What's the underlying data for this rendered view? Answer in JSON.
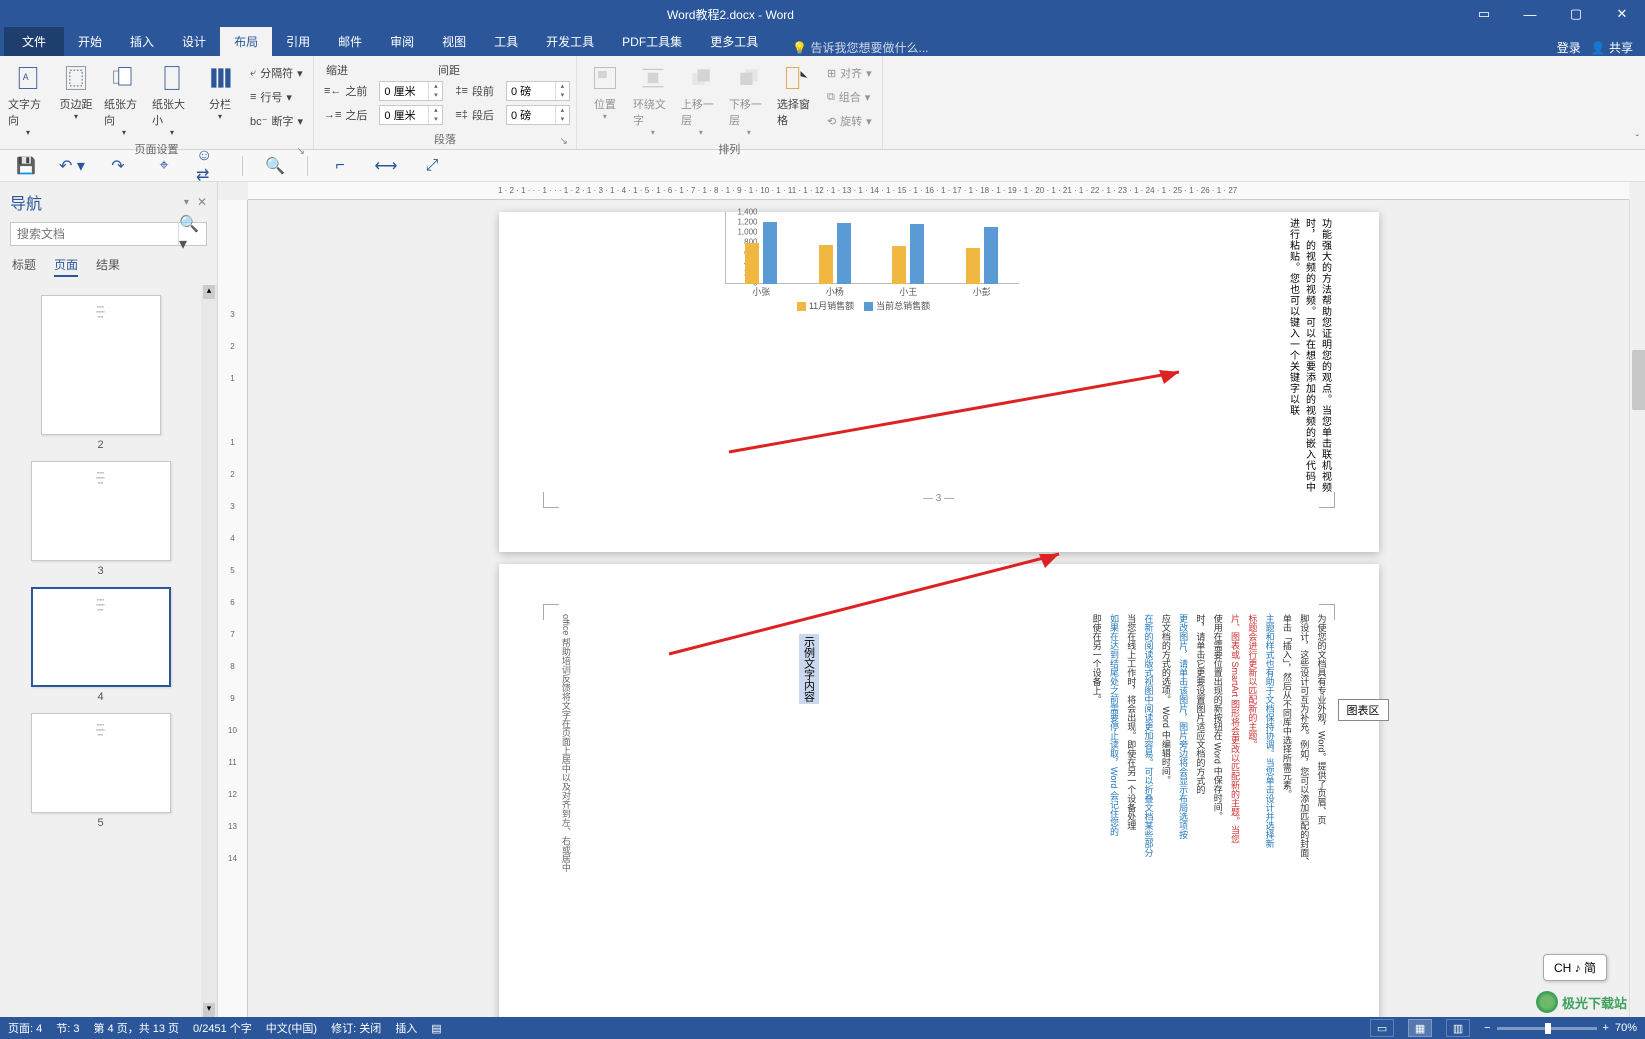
{
  "titlebar": {
    "title": "Word教程2.docx - Word",
    "btn_opts": "⋯",
    "min": "—",
    "max": "▢",
    "close": "✕",
    "ribbon_display": "▭"
  },
  "tabs": {
    "file": "文件",
    "items": [
      "开始",
      "插入",
      "设计",
      "布局",
      "引用",
      "邮件",
      "审阅",
      "视图",
      "工具",
      "开发工具",
      "PDF工具集",
      "更多工具"
    ],
    "active": "布局",
    "tell_me": "告诉我您想要做什么...",
    "login": "登录",
    "share": "共享"
  },
  "ribbon": {
    "page_setup": {
      "label": "页面设置",
      "text_dir": "文字方向",
      "margins": "页边距",
      "orientation": "纸张方向",
      "size": "纸张大小",
      "columns": "分栏",
      "breaks": "分隔符",
      "line_no": "行号",
      "hyphen": "断字"
    },
    "paragraph": {
      "label": "段落",
      "indent_label": "缩进",
      "before_label": "之前",
      "after_label": "之后",
      "left_val": "0 厘米",
      "right_val": "0 厘米",
      "spacing_label": "间距",
      "sp_before_label": "段前",
      "sp_after_label": "段后",
      "sp_before_val": "0 磅",
      "sp_after_val": "0 磅"
    },
    "arrange": {
      "label": "排列",
      "position": "位置",
      "wrap": "环绕文字",
      "forward": "上移一层",
      "backward": "下移一层",
      "selection": "选择窗格",
      "align": "对齐",
      "group": "组合",
      "rotate": "旋转"
    }
  },
  "qat": {
    "items": [
      "save",
      "undo",
      "redo",
      "touch",
      "coauth",
      "find",
      "tab-stops",
      "ruler",
      "outline"
    ]
  },
  "nav": {
    "title": "导航",
    "search_ph": "搜索文档",
    "subtabs": [
      "标题",
      "页面",
      "结果"
    ],
    "active": "页面",
    "thumbs": [
      {
        "n": "2",
        "landscape": false
      },
      {
        "n": "3",
        "landscape": true
      },
      {
        "n": "4",
        "landscape": true,
        "selected": true
      },
      {
        "n": "5",
        "landscape": true
      }
    ]
  },
  "chart_data": {
    "type": "bar",
    "categories": [
      "小张",
      "小杨",
      "小王",
      "小彭"
    ],
    "series": [
      {
        "name": "11月销售额",
        "values": [
          800,
          760,
          740,
          700
        ],
        "color": "#f0b840"
      },
      {
        "name": "当前总销售额",
        "values": [
          1200,
          1180,
          1160,
          1100
        ],
        "color": "#5b9bd5"
      }
    ],
    "ylim": [
      0,
      1400
    ],
    "yticks": [
      0,
      200,
      400,
      600,
      800,
      1000,
      1200,
      1400
    ],
    "title": "",
    "xlabel": "",
    "ylabel": ""
  },
  "doc": {
    "page3_vert": "功能强大的方法帮助您证明您的观点。当您单击联机视频时，的视频的视频。可以在想要添加的视频的嵌入代码中进行粘贴。您也可以键入一个关键字以联",
    "page3_num": "— 3 —",
    "page4_cols": [
      "为使您的文档具有专业外观，Word。提供了页眉、页",
      "脚设计，这些设计可互为补充。例如，您可以添加匹配的封面、",
      "单击「插入」，然后从不同库中选择所需元素。",
      "主题和样式也有助于文档保持协调。当您单击设计并选择新",
      "标题会进行更新以匹配新的主题。",
      "片、图表或 SmartArt 图形将会更改以匹配新的主题。当您",
      "使用在需要位置出现的新按钮在 Word 中保存时间。",
      "时，请单击它更要设置图片适应文档的方式的",
      "更改图片，请单击该图片，图片旁边将会显示布局选项按",
      "应文档的方式的选项。  Word 中编辑时间。",
      "在新的阅读版式视图中阅读更加容易。可以折叠文档某些部分",
      "当您在线上工作时，将会出现。即使在另一个设备处理",
      "如果在达到结尾处之前需要停止读取，Word 会记住您的",
      "即使在另一个设备上。"
    ],
    "page4_left": "office 帮助培训反馈将文字在页面上居中以及对齐到左、右或居中",
    "page4_sel": "示例文字内容"
  },
  "tooltip": "图表区",
  "hruler": "1 · 2 · 1 · · · 1 · · · 1 · 2 · 1 · 3 · 1 · 4 · 1 · 5 · 1 · 6 · 1 · 7 · 1 · 8 · 1 · 9 · 1 · 10 · 1 · 11 · 1 · 12 · 1 · 13 · 1 · 14 · 1 · 15 · 1 · 16 · 1 · 17 · 1 · 18 · 1 · 19 · 1 · 20 · 1 · 21 · 1 · 22 · 1 · 23 · 1 · 24 · 1 · 25 · 1 · 26 · 1 · 27",
  "vruler": [
    "3",
    "2",
    "1",
    "",
    "1",
    "2",
    "3",
    "4",
    "5",
    "6",
    "7",
    "8",
    "9",
    "10",
    "11",
    "12",
    "13",
    "14"
  ],
  "status": {
    "page": "页面: 4",
    "section": "节: 3",
    "page_of": "第 4 页，共 13 页",
    "words": "0/2451 个字",
    "lang": "中文(中国)",
    "track": "修订: 关闭",
    "insert": "插入",
    "zoom": "70%"
  },
  "ime": "CH ♪ 简",
  "watermark": "极光下载站"
}
